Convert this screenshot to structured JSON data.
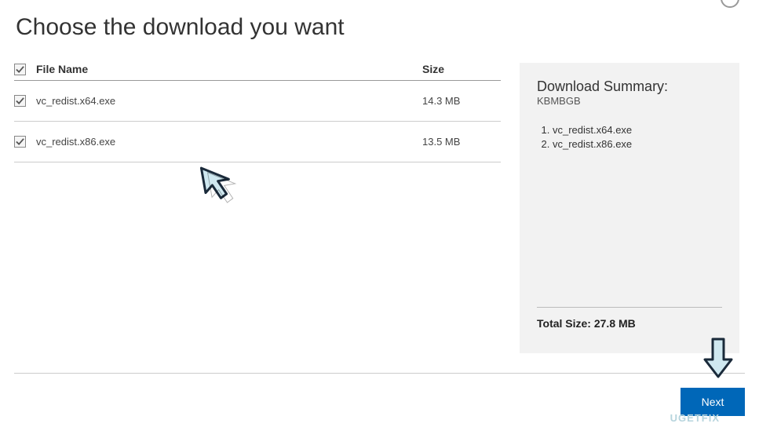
{
  "title": "Choose the download you want",
  "table": {
    "headers": {
      "filename": "File Name",
      "size": "Size"
    },
    "rows": [
      {
        "filename": "vc_redist.x64.exe",
        "size": "14.3 MB",
        "checked": true
      },
      {
        "filename": "vc_redist.x86.exe",
        "size": "13.5 MB",
        "checked": true
      }
    ]
  },
  "summary": {
    "title": "Download Summary:",
    "subtitle": "KBMBGB",
    "items": [
      "vc_redist.x64.exe",
      "vc_redist.x86.exe"
    ],
    "total_label": "Total Size: 27.8 MB"
  },
  "buttons": {
    "next": "Next"
  },
  "watermark": "UGETFIX"
}
